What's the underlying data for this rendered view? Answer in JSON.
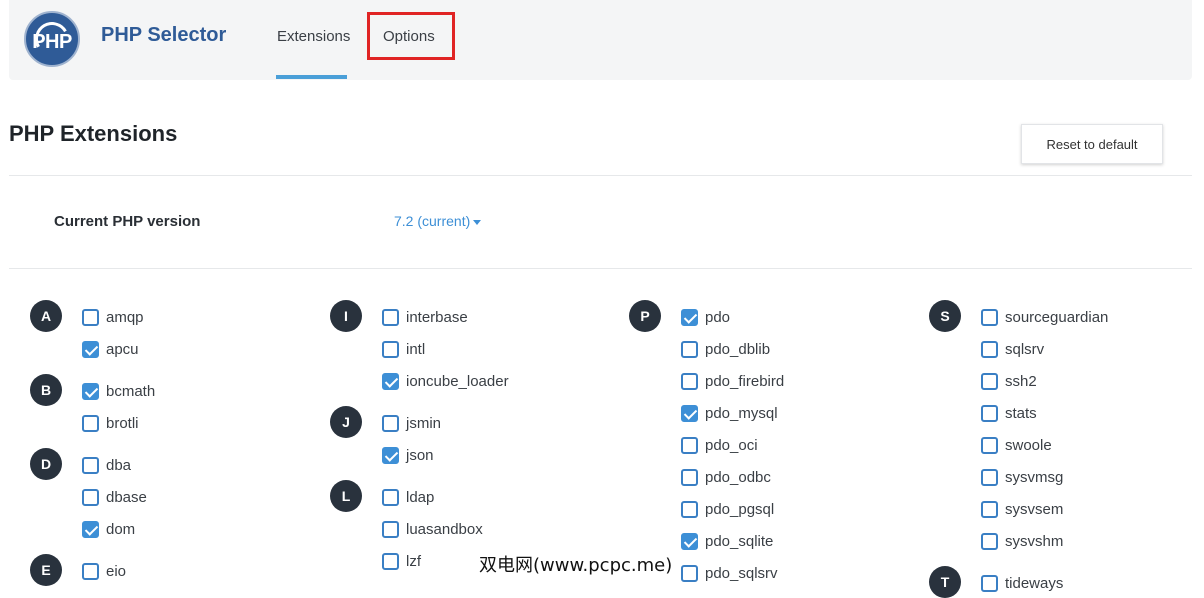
{
  "header": {
    "logo_text": "PHP",
    "app_title": "PHP Selector",
    "tabs": [
      {
        "label": "Extensions",
        "active": true
      },
      {
        "label": "Options",
        "active": false
      }
    ]
  },
  "page_title": "PHP Extensions",
  "reset_button": "Reset to default",
  "version": {
    "label": "Current PHP version",
    "value": "7.2 (current)"
  },
  "groups": [
    {
      "letter": "A",
      "items": [
        {
          "name": "amqp",
          "checked": false
        },
        {
          "name": "apcu",
          "checked": true
        }
      ]
    },
    {
      "letter": "B",
      "items": [
        {
          "name": "bcmath",
          "checked": true
        },
        {
          "name": "brotli",
          "checked": false
        }
      ]
    },
    {
      "letter": "D",
      "items": [
        {
          "name": "dba",
          "checked": false
        },
        {
          "name": "dbase",
          "checked": false
        },
        {
          "name": "dom",
          "checked": true
        }
      ]
    },
    {
      "letter": "E",
      "items": [
        {
          "name": "eio",
          "checked": false
        }
      ]
    },
    {
      "letter": "I",
      "items": [
        {
          "name": "interbase",
          "checked": false
        },
        {
          "name": "intl",
          "checked": false
        },
        {
          "name": "ioncube_loader",
          "checked": true
        }
      ]
    },
    {
      "letter": "J",
      "items": [
        {
          "name": "jsmin",
          "checked": false
        },
        {
          "name": "json",
          "checked": true
        }
      ]
    },
    {
      "letter": "L",
      "items": [
        {
          "name": "ldap",
          "checked": false
        },
        {
          "name": "luasandbox",
          "checked": false
        },
        {
          "name": "lzf",
          "checked": false
        }
      ]
    },
    {
      "letter": "P",
      "items": [
        {
          "name": "pdo",
          "checked": true
        },
        {
          "name": "pdo_dblib",
          "checked": false
        },
        {
          "name": "pdo_firebird",
          "checked": false
        },
        {
          "name": "pdo_mysql",
          "checked": true
        },
        {
          "name": "pdo_oci",
          "checked": false
        },
        {
          "name": "pdo_odbc",
          "checked": false
        },
        {
          "name": "pdo_pgsql",
          "checked": false
        },
        {
          "name": "pdo_sqlite",
          "checked": true
        },
        {
          "name": "pdo_sqlsrv",
          "checked": false
        }
      ]
    },
    {
      "letter": "S",
      "items": [
        {
          "name": "sourceguardian",
          "checked": false
        },
        {
          "name": "sqlsrv",
          "checked": false
        },
        {
          "name": "ssh2",
          "checked": false
        },
        {
          "name": "stats",
          "checked": false
        },
        {
          "name": "swoole",
          "checked": false
        },
        {
          "name": "sysvmsg",
          "checked": false
        },
        {
          "name": "sysvsem",
          "checked": false
        },
        {
          "name": "sysvshm",
          "checked": false
        }
      ]
    },
    {
      "letter": "T",
      "items": [
        {
          "name": "tideways",
          "checked": false
        }
      ]
    }
  ],
  "watermark": "双电网(www.pcpc.me)",
  "colors": {
    "brand": "#2f5b97",
    "accent": "#3d8fd6",
    "highlight_box": "#e02424",
    "letter_badge": "#29323d"
  }
}
